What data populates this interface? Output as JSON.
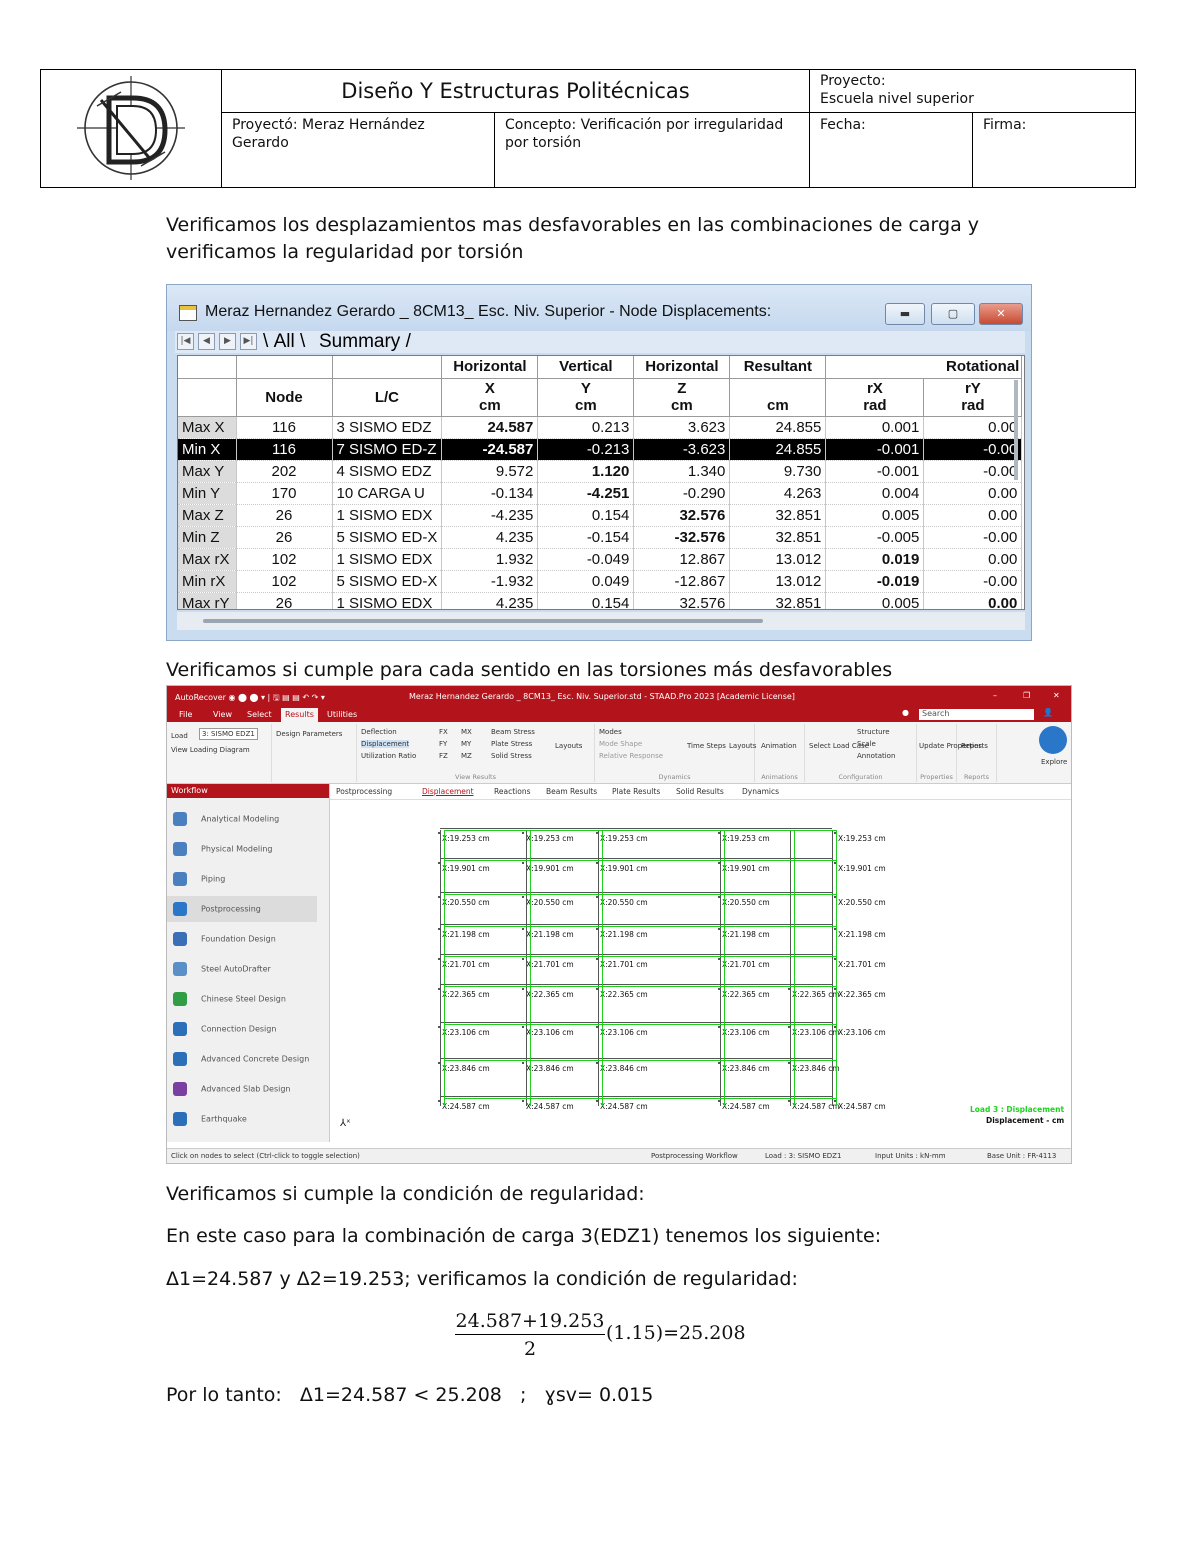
{
  "header": {
    "title": "Diseño Y Estructuras Politécnicas",
    "project_label": "Proyecto:",
    "project_value": "Escuela nivel superior",
    "author": "Proyectó: Meraz Hernández Gerardo",
    "concept": "Concepto: Verificación por irregularidad por torsión",
    "date_label": "Fecha:",
    "sign_label": "Firma:"
  },
  "text": {
    "intro": "Verificamos los desplazamientos mas desfavorables en las combinaciones de carga y verificamos la regularidad por torsión",
    "check_dir": "Verificamos si cumple para cada sentido en las torsiones más desfavorables",
    "check_cond": "Verificamos si cumple la condición de regularidad:",
    "case_text": "En este caso para la combinación de carga 3(EDZ1) tenemos los siguiente:",
    "deltas": "Δ1=24.587 y Δ2=19.253; verificamos la condición de regularidad:",
    "formula_num": "24.587+19.253",
    "formula_den": "2",
    "formula_tail": "(1.15)=25.208",
    "conclusion": "Por lo tanto:   Δ1=24.587 < 25.208   ;   ɣsv= 0.015"
  },
  "table_window": {
    "title": "Meraz Hernandez Gerardo _ 8CM13_ Esc. Niv. Superior - Node Displacements:",
    "tabs": [
      "All",
      "Summary"
    ],
    "group_headers": [
      "Horizontal",
      "Vertical",
      "Horizontal",
      "Resultant",
      "Rotational"
    ],
    "col_headers": [
      "Node",
      "L/C",
      "X",
      "Y",
      "Z",
      "",
      "rX",
      "rY"
    ],
    "units": [
      "cm",
      "cm",
      "cm",
      "cm",
      "rad",
      "rad"
    ],
    "rows": [
      {
        "label": "Max X",
        "node": "116",
        "lc": "3 SISMO EDZ",
        "x": "24.587",
        "y": "0.213",
        "z": "3.623",
        "res": "24.855",
        "rx": "0.001",
        "ry": "0.00"
      },
      {
        "label": "Min X",
        "node": "116",
        "lc": "7 SISMO ED-Z",
        "x": "-24.587",
        "y": "-0.213",
        "z": "-3.623",
        "res": "24.855",
        "rx": "-0.001",
        "ry": "-0.00"
      },
      {
        "label": "Max Y",
        "node": "202",
        "lc": "4 SISMO EDZ",
        "x": "9.572",
        "y": "1.120",
        "z": "1.340",
        "res": "9.730",
        "rx": "-0.001",
        "ry": "-0.00"
      },
      {
        "label": "Min Y",
        "node": "170",
        "lc": "10 CARGA U",
        "x": "-0.134",
        "y": "-4.251",
        "z": "-0.290",
        "res": "4.263",
        "rx": "0.004",
        "ry": "0.00"
      },
      {
        "label": "Max Z",
        "node": "26",
        "lc": "1 SISMO EDX",
        "x": "-4.235",
        "y": "0.154",
        "z": "32.576",
        "res": "32.851",
        "rx": "0.005",
        "ry": "0.00"
      },
      {
        "label": "Min Z",
        "node": "26",
        "lc": "5 SISMO ED-X",
        "x": "4.235",
        "y": "-0.154",
        "z": "-32.576",
        "res": "32.851",
        "rx": "-0.005",
        "ry": "-0.00"
      },
      {
        "label": "Max rX",
        "node": "102",
        "lc": "1 SISMO EDX",
        "x": "1.932",
        "y": "-0.049",
        "z": "12.867",
        "res": "13.012",
        "rx": "0.019",
        "ry": "0.00"
      },
      {
        "label": "Min rX",
        "node": "102",
        "lc": "5 SISMO ED-X",
        "x": "-1.932",
        "y": "0.049",
        "z": "-12.867",
        "res": "13.012",
        "rx": "-0.019",
        "ry": "-0.00"
      },
      {
        "label": "Max rY",
        "node": "26",
        "lc": "1 SISMO EDX",
        "x": "4.235",
        "y": "0.154",
        "z": "32.576",
        "res": "32.851",
        "rx": "0.005",
        "ry": "0.00"
      }
    ]
  },
  "app": {
    "title": "Meraz Hernandez Gerardo _ 8CM13_ Esc. Niv. Superior.std - STAAD.Pro 2023 [Academic License]",
    "menu": [
      "File",
      "View",
      "Select",
      "Results",
      "Utilities"
    ],
    "search_placeholder": "Search",
    "ribbon": {
      "load_label": "Load",
      "load_value": "3: SISMO EDZ1",
      "view_loading": "View Loading Diagram",
      "design_params": "Design Parameters",
      "deflection": "Deflection",
      "displacement": "Displacement",
      "utilization": "Utilization Ratio",
      "fx": "FX",
      "fy": "FY",
      "fz": "FZ",
      "mx": "MX",
      "my": "MY",
      "mz": "MZ",
      "beam_stress": "Beam Stress",
      "plate_stress": "Plate Stress",
      "solid_stress": "Solid Stress",
      "layouts": "Layouts",
      "view_results": "View Results",
      "modes": "Modes",
      "mode_shape": "Mode Shape",
      "rel_resp": "Relative Response",
      "time_steps": "Time Steps",
      "layouts2": "Layouts",
      "dynamics": "Dynamics",
      "animation": "Animation",
      "animations": "Animations",
      "select_load_case": "Select Load Case",
      "structure": "Structure",
      "scale": "Scale",
      "annotation": "Annotation",
      "configuration": "Configuration",
      "update_properties": "Update Properties",
      "properties": "Properties",
      "reports": "Reports",
      "reports_g": "Reports",
      "explore": "Explore"
    },
    "sidebar_title": "Workflow",
    "workflow": [
      "Analytical Modeling",
      "Physical Modeling",
      "Piping",
      "Postprocessing",
      "Foundation Design",
      "Steel AutoDrafter",
      "Chinese Steel Design",
      "Connection Design",
      "Advanced Concrete Design",
      "Advanced Slab Design",
      "Earthquake"
    ],
    "subtabs": [
      "Postprocessing",
      "Displacement",
      "Reactions",
      "Beam Results",
      "Plate Results",
      "Solid Results",
      "Dynamics"
    ],
    "legend_load": "Load 3 : Displacement",
    "legend_units": "Displacement - cm",
    "status": [
      "Click on nodes to select (Ctrl-click to toggle selection)",
      "Postprocessing Workflow",
      "Load : 3: SISMO EDZ1",
      "Input Units : kN-mm",
      "Base Unit : FR-4113"
    ],
    "labels": [
      "X:19.253 cm",
      "X:19.253 cm",
      "X:19.253 cm",
      "X:19.253 cm",
      "X:19.253 cm",
      "X:19.901 cm",
      "X:19.901 cm",
      "X:19.901 cm",
      "X:19.901 cm",
      "X:19.901 cm",
      "X:20.550 cm",
      "X:20.550 cm",
      "X:20.550 cm",
      "X:20.550 cm",
      "X:20.550 cm",
      "X:21.198 cm",
      "X:21.198 cm",
      "X:21.198 cm",
      "X:21.198 cm",
      "X:21.198 cm",
      "X:21.701 cm",
      "X:21.701 cm",
      "X:21.701 cm",
      "X:21.701 cm",
      "X:21.701 cm",
      "X:22.365 cm",
      "X:22.365 cm",
      "X:22.365 cm",
      "X:22.365 cm",
      "X:22.365 cm",
      "X:22.365 cm",
      "X:23.106 cm",
      "X:23.106 cm",
      "X:23.106 cm",
      "X:23.106 cm",
      "X:23.106 cm",
      "X:23.106 cm",
      "X:23.846 cm",
      "X:23.846 cm",
      "X:23.846 cm",
      "X:23.846 cm",
      "X:23.846 cm",
      "X:24.587 cm",
      "X:24.587 cm",
      "X:24.587 cm",
      "X:24.587 cm",
      "X:24.587 cm",
      "X:24.587 cm"
    ]
  }
}
